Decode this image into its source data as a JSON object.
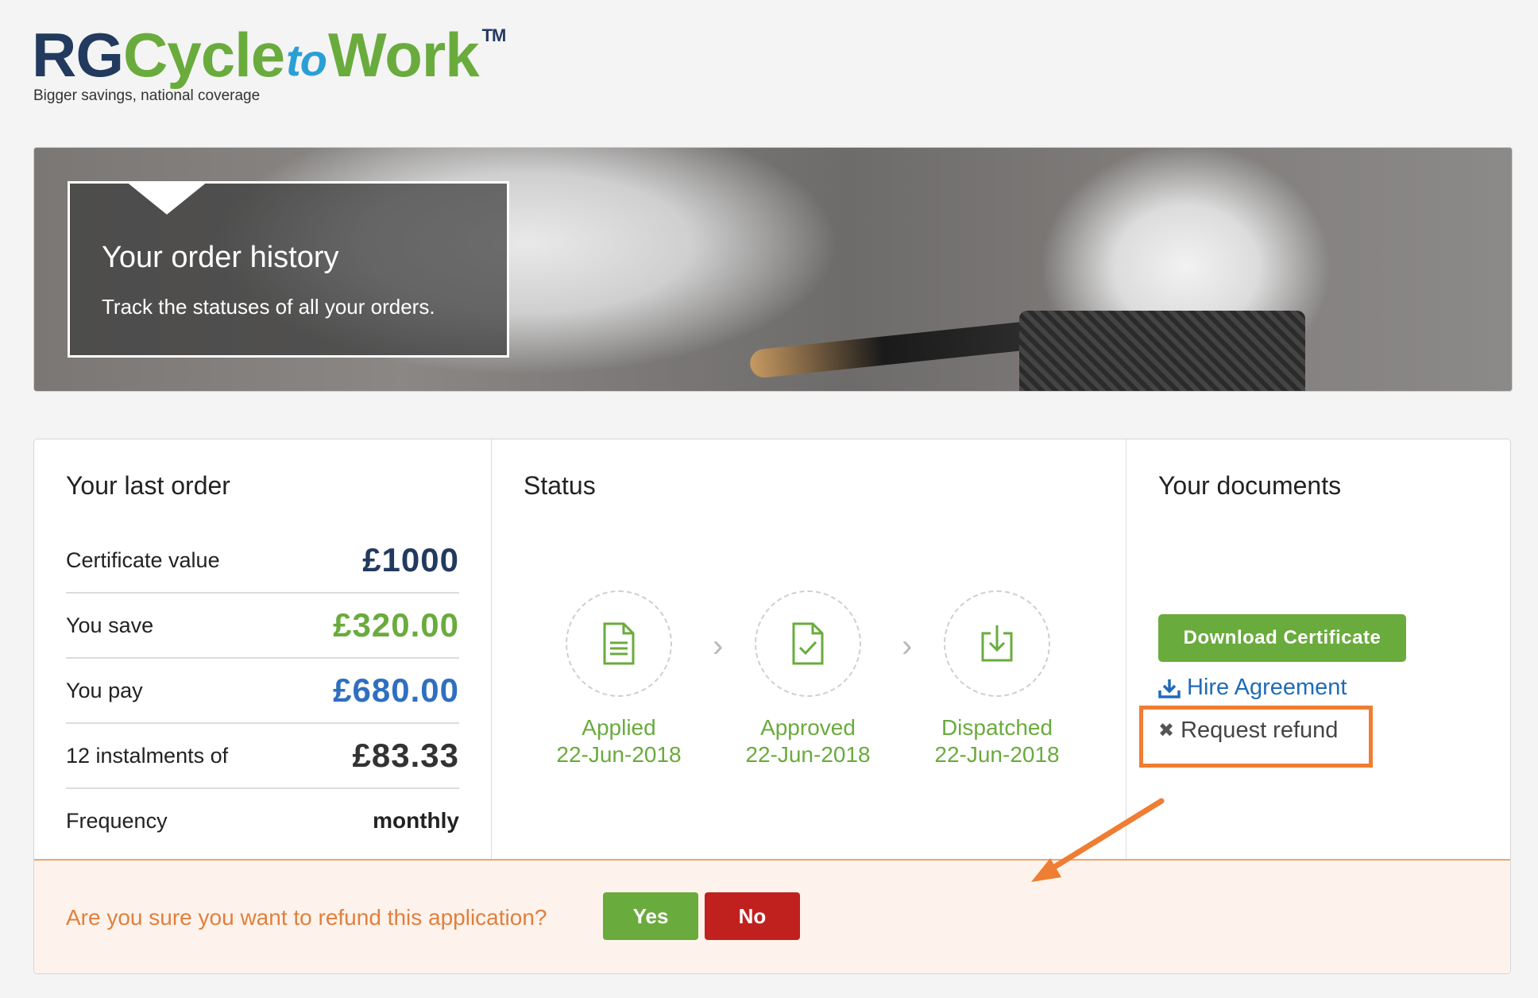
{
  "brand": {
    "rg": "RG",
    "cycle": "Cycle",
    "to": "to",
    "work": "Work",
    "tm": "TM",
    "tagline": "Bigger savings, national coverage"
  },
  "hero": {
    "title": "Your order history",
    "subtitle": "Track the statuses of all your orders."
  },
  "last_order": {
    "heading": "Your last order",
    "rows": [
      {
        "label": "Certificate value",
        "value": "£1000",
        "color": "#223a5e"
      },
      {
        "label": "You save",
        "value": "£320.00",
        "color": "#6aab3d"
      },
      {
        "label": "You pay",
        "value": "£680.00",
        "color": "#2f6fc0"
      },
      {
        "label": "12 instalments of",
        "value": "£83.33",
        "color": "#333333"
      },
      {
        "label": "Frequency",
        "value": "monthly",
        "color": "#222222"
      }
    ]
  },
  "status": {
    "heading": "Status",
    "steps": [
      {
        "label": "Applied",
        "date": "22-Jun-2018",
        "icon": "document-icon"
      },
      {
        "label": "Approved",
        "date": "22-Jun-2018",
        "icon": "document-check-icon"
      },
      {
        "label": "Dispatched",
        "date": "22-Jun-2018",
        "icon": "download-icon"
      }
    ]
  },
  "documents": {
    "heading": "Your documents",
    "download_label": "Download Certificate",
    "hire_label": "Hire Agreement",
    "refund_label": "Request refund"
  },
  "confirm": {
    "question": "Are you sure you want to refund this application?",
    "yes_label": "Yes",
    "no_label": "No"
  },
  "colors": {
    "green": "#6aab3d",
    "navy": "#223a5e",
    "blue": "#2f6fc0",
    "red": "#c0211f",
    "orange": "#ef7d32"
  }
}
